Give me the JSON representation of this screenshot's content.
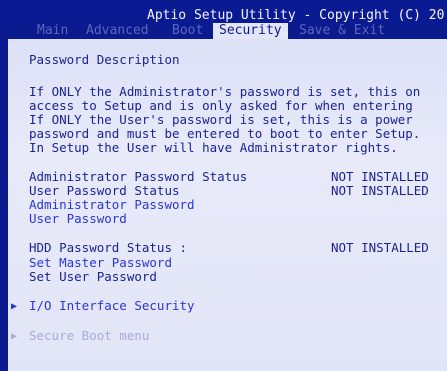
{
  "app": {
    "title": "Aptio Setup Utility - Copyright (C) 20"
  },
  "tabs": [
    {
      "label": "Main"
    },
    {
      "label": "Advanced"
    },
    {
      "label": "Boot"
    },
    {
      "label": "Security"
    },
    {
      "label": "Save & Exit"
    }
  ],
  "security": {
    "heading": "Password Description",
    "description": [
      "If ONLY the Administrator's password is set, this on",
      "access to Setup and is only asked for when entering",
      "If ONLY the User's password is set, this is a power",
      "password and must be entered to boot to enter Setup.",
      "In Setup the User will have Administrator rights."
    ],
    "status_rows": [
      {
        "label": "Administrator Password Status",
        "value": "NOT INSTALLED"
      },
      {
        "label": "User Password Status",
        "value": "NOT INSTALLED"
      }
    ],
    "admin_password": "Administrator Password",
    "user_password": "User Password",
    "hdd_status": {
      "label": "HDD Password Status  :",
      "value": "NOT INSTALLED"
    },
    "set_master_password": "Set Master Password",
    "set_user_password": "Set User Password",
    "io_security": {
      "arrow": "▶",
      "label": "I/O Interface Security"
    },
    "secure_boot": {
      "arrow": "▶",
      "label": "Secure Boot menu"
    }
  }
}
